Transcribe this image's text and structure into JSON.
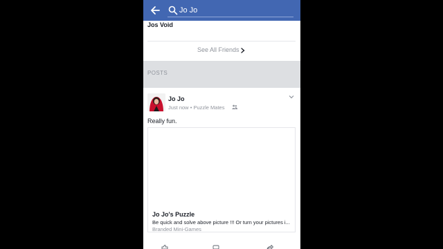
{
  "search": {
    "query": "Jo Jo"
  },
  "friends": {
    "items": [
      "Jos Void"
    ],
    "see_all_label": "See All Friends"
  },
  "posts_section": {
    "label": "POSTS"
  },
  "post": {
    "author": "Jo Jo",
    "time": "Just now",
    "separator": "•",
    "audience": "Puzzle Mates",
    "text": "Really fun.",
    "attachment": {
      "title": "Jo Jo's Puzzle",
      "description": "Be quick and solve above picture !!! Or turn your pictures i...",
      "source": "Branded Mini-Games"
    }
  },
  "colors": {
    "header": "#4267b2",
    "background": "#000000",
    "section_band": "#dddfe2"
  },
  "icons": [
    "back-arrow-icon",
    "search-icon",
    "chevron-right-icon",
    "friends-audience-icon",
    "chevron-down-icon",
    "like-icon",
    "comment-icon",
    "share-icon"
  ]
}
